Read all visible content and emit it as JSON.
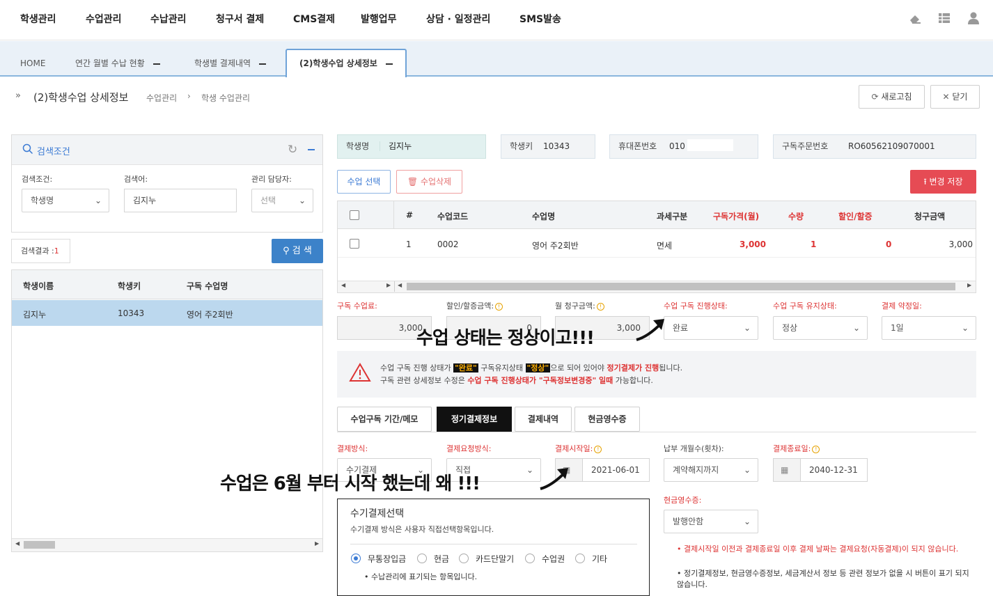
{
  "nav": {
    "items": [
      "학생관리",
      "수업관리",
      "수납관리",
      "청구서 결제",
      "CMS결제",
      "발행업무",
      "상담 · 일정관리",
      "SMS발송"
    ],
    "icons": [
      "eraser-icon",
      "grid-icon",
      "user-icon"
    ]
  },
  "tabs": [
    {
      "label": "HOME"
    },
    {
      "label": "연간 월별 수납 현황"
    },
    {
      "label": "학생별 결제내역"
    },
    {
      "label": "(2)학생수업 상세정보"
    }
  ],
  "page": {
    "title": "(2)학생수업 상세정보",
    "crumb1": "수업관리",
    "crumb2": "학생 수업관리",
    "refresh": "새로고침",
    "close": "닫기"
  },
  "search": {
    "title": "검색조건",
    "cond_label": "검색조건:",
    "cond_value": "학생명",
    "word_label": "검색어:",
    "word_value": "김지누",
    "mgr_label": "관리 담당자:",
    "mgr_value": "선택",
    "result_label": "검색결과 :",
    "result_count": "1",
    "search_btn": "검 색"
  },
  "result_table": {
    "headers": [
      "학생이름",
      "학생키",
      "구독 수업명"
    ],
    "rows": [
      [
        "김지누",
        "10343",
        "영어 주2회반"
      ]
    ]
  },
  "student": {
    "name_label": "학생명",
    "name": "김지누",
    "key_label": "학생키",
    "key": "10343",
    "phone_label": "휴대폰번호",
    "phone": "010",
    "order_label": "구독주문번호",
    "order": "RO60562109070001"
  },
  "actions": {
    "select": "수업 선택",
    "delete": "수업삭제",
    "save": "변경 저장"
  },
  "class_table": {
    "headers": [
      "#",
      "수업코드",
      "수업명",
      "과세구분",
      "구독가격(월)",
      "수량",
      "할인/할증",
      "청구금액"
    ],
    "rows": [
      [
        "1",
        "0002",
        "영어 주2회반",
        "면세",
        "3,000",
        "1",
        "0",
        "3,000"
      ]
    ]
  },
  "fees": {
    "fee_label": "구독 수업료:",
    "fee": "3,000",
    "disc_label": "할인/할증금액:",
    "disc": "0",
    "month_label": "월 청구금액:",
    "month": "3,000",
    "status_label": "수업 구독 진행상태:",
    "status": "완료",
    "keep_label": "수업 구독 유지상태:",
    "keep": "정상",
    "day_label": "결제 약정일:",
    "day": "1일"
  },
  "notice": {
    "l1a": "수업 구독 진행 상태가 ",
    "l1b": "\"완료\"",
    "l1c": " 구독유지상태 ",
    "l1d": "\"정상\"",
    "l1e": "으로 되어 있어야 ",
    "l1f": "정기결제가 진행",
    "l1g": "됩니다.",
    "l2a": "구독 관련 상세정보 수정은 ",
    "l2b": "수업 구독 진행상태가 \"구독정보변경중\" 일때",
    "l2c": " 가능합니다."
  },
  "subtabs": [
    "수업구독 기간/메모",
    "정기결제정보",
    "결제내역",
    "현금영수증"
  ],
  "payment": {
    "method_label": "결제방식:",
    "method": "수기결제",
    "req_label": "결제요청방식:",
    "req": "직접",
    "start_label": "결제시작일:",
    "start": "2021-06-01",
    "months_label": "납부 개월수(횟차):",
    "months": "계약해지까지",
    "end_label": "결제종료일:",
    "end": "2040-12-31",
    "receipt_label": "현금영수증:",
    "receipt": "발행안함"
  },
  "manual": {
    "title": "수기결제선택",
    "desc": "수기결제 방식은 사용자 직접선택항목입니다.",
    "options": [
      "무통장입금",
      "현금",
      "카드단말기",
      "수업권",
      "기타"
    ],
    "note": "수납관리에 표기되는 항목입니다."
  },
  "notes": {
    "n1": "결제시작일 이전과 결제종료일 이후 결제 날짜는 결제요청(자동결제)이 되지 않습니다.",
    "n2": "정기결제정보, 현금영수증정보, 세금계산서 정보 등 관련 정보가 없을 시 버튼이 표기 되지 않습니다."
  },
  "annotations": {
    "a1": "수업 상태는 정상이고!!!",
    "a2": "수업은 6월 부터 시작 했는데 왜 !!!"
  }
}
